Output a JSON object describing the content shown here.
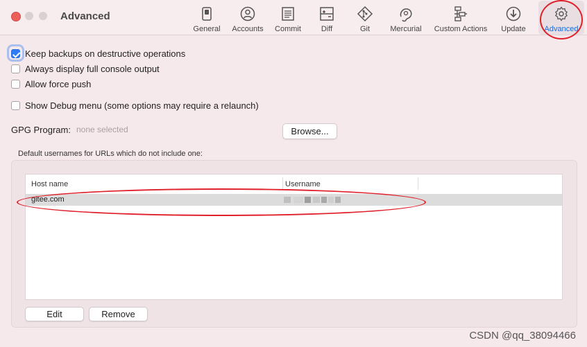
{
  "window": {
    "title": "Advanced"
  },
  "toolbar": {
    "items": [
      {
        "label": "General",
        "icon": "general-icon"
      },
      {
        "label": "Accounts",
        "icon": "accounts-icon"
      },
      {
        "label": "Commit",
        "icon": "commit-icon"
      },
      {
        "label": "Diff",
        "icon": "diff-icon"
      },
      {
        "label": "Git",
        "icon": "git-icon"
      },
      {
        "label": "Mercurial",
        "icon": "mercurial-icon"
      },
      {
        "label": "Custom Actions",
        "icon": "custom-actions-icon"
      },
      {
        "label": "Update",
        "icon": "update-icon"
      },
      {
        "label": "Advanced",
        "icon": "gear-icon",
        "active": true
      }
    ],
    "active_color": "#1a6ad8"
  },
  "options": {
    "keep_backups": {
      "label": "Keep backups on destructive operations",
      "checked": true
    },
    "full_console": {
      "label": "Always display full console output",
      "checked": false
    },
    "force_push": {
      "label": "Allow force push",
      "checked": false
    },
    "debug_menu": {
      "label": "Show Debug menu (some options may require a relaunch)",
      "checked": false
    }
  },
  "gpg": {
    "label": "GPG Program:",
    "value": "none selected",
    "browse_label": "Browse..."
  },
  "usernames": {
    "section_label": "Default usernames for URLs which do not include one:",
    "columns": [
      "Host name",
      "Username"
    ],
    "rows": [
      {
        "host": "gitee.com",
        "username": "[redacted]"
      }
    ],
    "edit_label": "Edit",
    "remove_label": "Remove"
  },
  "annotation_color": "#e0202a",
  "watermark": "CSDN @qq_38094466"
}
